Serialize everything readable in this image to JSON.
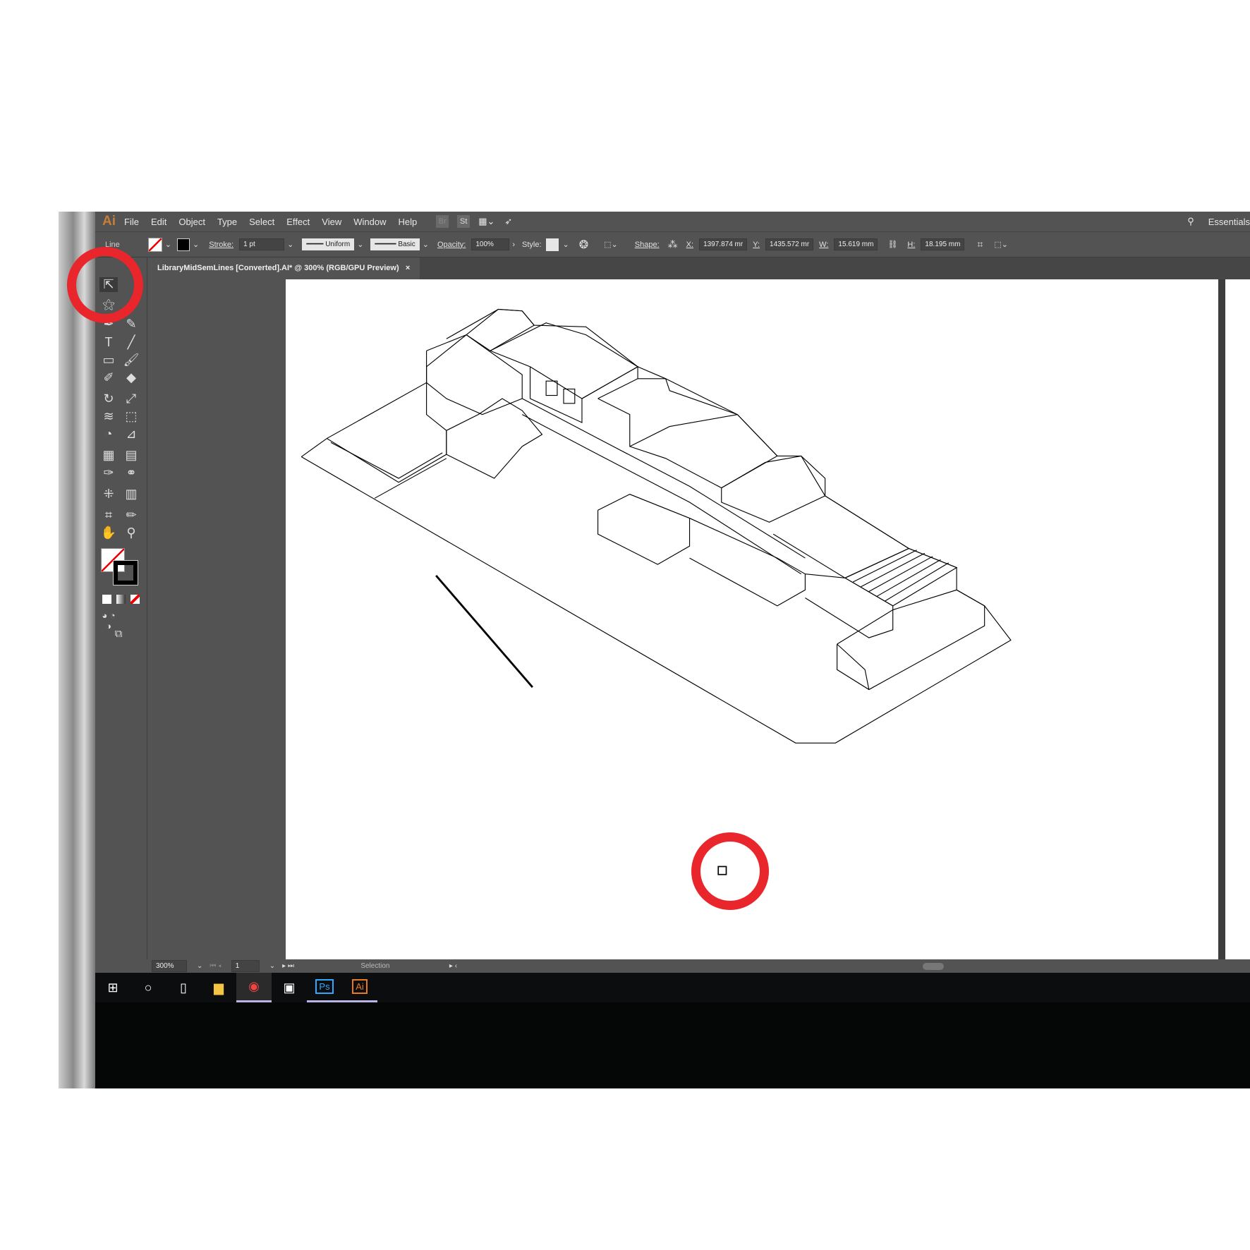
{
  "menubar": {
    "logo": "Ai",
    "items": [
      "File",
      "Edit",
      "Object",
      "Type",
      "Select",
      "Effect",
      "View",
      "Window",
      "Help"
    ],
    "bridge": "Br",
    "stock": "St",
    "workspace": "Essentials"
  },
  "control": {
    "selection_type": "Line",
    "stroke_label": "Stroke:",
    "stroke_value": "1 pt",
    "profile": "Uniform",
    "brush": "Basic",
    "opacity_label": "Opacity:",
    "opacity_value": "100%",
    "style_label": "Style:",
    "shape_label": "Shape:",
    "x_label": "X:",
    "x_value": "1397.874 mr",
    "y_label": "Y:",
    "y_value": "1435.572 mr",
    "w_label": "W:",
    "w_value": "15.619 mm",
    "h_label": "H:",
    "h_value": "18.195 mm"
  },
  "document": {
    "tab_title": "LibraryMidSemLines [Converted].AI* @ 300% (RGB/GPU Preview)",
    "close": "×"
  },
  "status": {
    "zoom": "300%",
    "artboard": "1",
    "tool": "Selection"
  },
  "taskbar": {
    "apps": [
      "Ps",
      "Ai"
    ]
  },
  "colors": {
    "highlight": "#e8262b",
    "ai_orange": "#c77d3b",
    "ps_blue": "#31a8ff"
  }
}
